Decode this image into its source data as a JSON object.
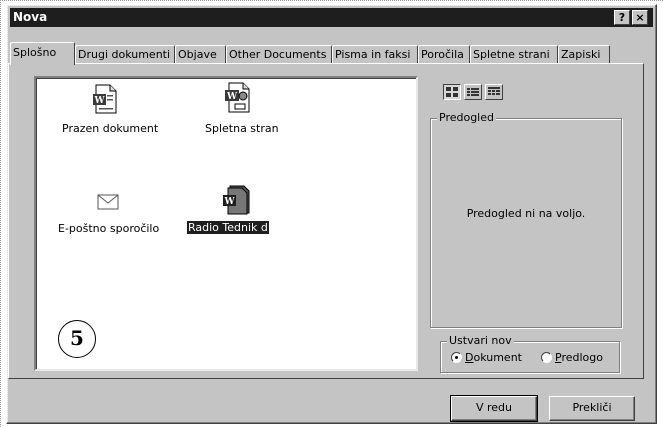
{
  "window": {
    "title": "Nova",
    "help_button": "?",
    "close_button": "×"
  },
  "tabs": [
    {
      "label": "Splošno",
      "active": true
    },
    {
      "label": "Drugi dokumenti"
    },
    {
      "label": "Objave"
    },
    {
      "label": "Other Documents"
    },
    {
      "label": "Pisma in faksi"
    },
    {
      "label": "Poročila"
    },
    {
      "label": "Spletne strani"
    },
    {
      "label": "Zapiski"
    }
  ],
  "templates": [
    {
      "label": "Prazen dokument",
      "icon": "word-document-icon"
    },
    {
      "label": "Spletna stran",
      "icon": "web-page-icon"
    },
    {
      "label": "E-poštno sporočilo",
      "icon": "envelope-icon"
    },
    {
      "label": "Radio Tednik d",
      "icon": "word-template-icon",
      "selected": true
    }
  ],
  "annotation_number": "5",
  "view_buttons": [
    "large-icons",
    "list",
    "details"
  ],
  "preview": {
    "legend": "Predogled",
    "message": "Predogled ni na voljo."
  },
  "create_new": {
    "legend": "Ustvari nov",
    "options": [
      {
        "label_key": "D",
        "label_rest": "okument",
        "checked": true
      },
      {
        "label_key": "P",
        "label_rest": "redlogo",
        "checked": false
      }
    ]
  },
  "buttons": {
    "ok": "V redu",
    "cancel": "Prekliči"
  }
}
